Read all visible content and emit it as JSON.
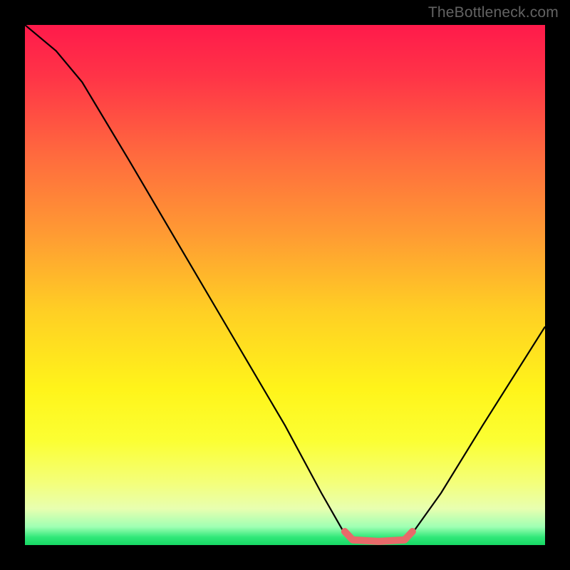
{
  "watermark": {
    "text": "TheBottleneck.com"
  },
  "gradient": {
    "stops": [
      {
        "offset": 0.0,
        "color": "#ff1a4b"
      },
      {
        "offset": 0.1,
        "color": "#ff3447"
      },
      {
        "offset": 0.25,
        "color": "#ff6a3e"
      },
      {
        "offset": 0.4,
        "color": "#ff9a33"
      },
      {
        "offset": 0.55,
        "color": "#ffcf24"
      },
      {
        "offset": 0.7,
        "color": "#fff41a"
      },
      {
        "offset": 0.8,
        "color": "#fbff33"
      },
      {
        "offset": 0.88,
        "color": "#f4ff7a"
      },
      {
        "offset": 0.93,
        "color": "#e8ffb0"
      },
      {
        "offset": 0.965,
        "color": "#9fffb3"
      },
      {
        "offset": 0.985,
        "color": "#30e879"
      },
      {
        "offset": 1.0,
        "color": "#17d964"
      }
    ]
  },
  "chart_data": {
    "type": "line",
    "title": "",
    "xlabel": "",
    "ylabel": "",
    "x_range": [
      0,
      100
    ],
    "y_range": [
      0,
      100
    ],
    "series": [
      {
        "name": "bottleneck-curve",
        "color": "#000000",
        "points": [
          {
            "x": 0,
            "y": 100
          },
          {
            "x": 6,
            "y": 95
          },
          {
            "x": 11,
            "y": 89
          },
          {
            "x": 20,
            "y": 74
          },
          {
            "x": 30,
            "y": 57
          },
          {
            "x": 40,
            "y": 40
          },
          {
            "x": 50,
            "y": 23
          },
          {
            "x": 57,
            "y": 10
          },
          {
            "x": 61,
            "y": 3
          },
          {
            "x": 64,
            "y": 0.5
          },
          {
            "x": 72,
            "y": 0.5
          },
          {
            "x": 75,
            "y": 3
          },
          {
            "x": 80,
            "y": 10
          },
          {
            "x": 88,
            "y": 23
          },
          {
            "x": 100,
            "y": 42
          }
        ]
      },
      {
        "name": "optimal-range-marker",
        "color": "#e86a6a",
        "points": [
          {
            "x": 61.5,
            "y": 2.6
          },
          {
            "x": 63,
            "y": 1.0
          },
          {
            "x": 68,
            "y": 0.7
          },
          {
            "x": 73,
            "y": 1.0
          },
          {
            "x": 74.5,
            "y": 2.6
          }
        ]
      }
    ]
  }
}
